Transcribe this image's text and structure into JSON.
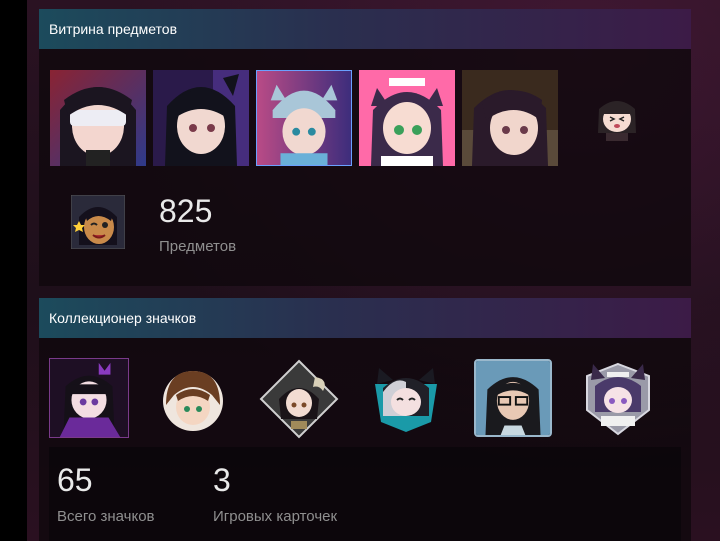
{
  "showcase": {
    "title": "Витрина предметов",
    "items": [
      {
        "name": "anime-girl-blindfold",
        "hair": "#1b1520",
        "bg": "#8a2333",
        "bg2": "#2e3a8a"
      },
      {
        "name": "anime-catgirl-black",
        "hair": "#12121c",
        "bg": "#4a2a7a",
        "bg2": "#1b1b3a"
      },
      {
        "name": "anime-girl-cat-hat",
        "hair": "#1d2a3a",
        "bg": "#b94b86",
        "bg2": "#3d2d7c"
      },
      {
        "name": "anime-maid-catgirl",
        "hair": "#3b2a4a",
        "bg": "#ff6aa8",
        "bg2": "#ffc2d8"
      },
      {
        "name": "anime-girl-short-hair",
        "hair": "#2a1a2a",
        "bg": "#3a2a1e",
        "bg2": "#6a5a3a"
      },
      {
        "name": "chibi-girl-emote",
        "hair": "#2b2326",
        "bg": "#1a1018",
        "bg2": "#1a1018"
      }
    ],
    "featured_emoticon": "winking-girl-emote",
    "count": "825",
    "count_label": "Предметов"
  },
  "badges": {
    "title": "Коллекционер значков",
    "items": [
      {
        "name": "badge-purple-crown-girl",
        "color": "#7a3aa8"
      },
      {
        "name": "badge-brown-hair-girl",
        "color": "#7a4a2a"
      },
      {
        "name": "badge-horned-girl",
        "color": "#8a8a8a"
      },
      {
        "name": "badge-teal-catgirl",
        "color": "#2aa8b0"
      },
      {
        "name": "badge-glasses-woman",
        "color": "#6aa0c0"
      },
      {
        "name": "badge-purple-maid-cat",
        "color": "#7a6ab0"
      }
    ],
    "total_badges": "65",
    "total_badges_label": "Всего значков",
    "trading_cards": "3",
    "trading_cards_label": "Игровых карточек"
  }
}
